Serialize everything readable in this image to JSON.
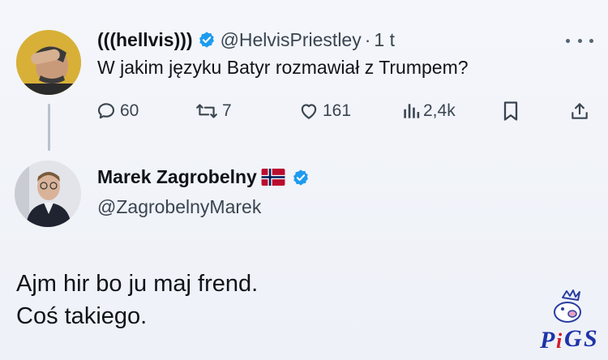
{
  "tweet1": {
    "display_name": "(((hellvis)))",
    "handle": "@HelvisPriestley",
    "separator": "·",
    "time": "1 t",
    "text": "W jakim języku Batyr rozmawiał z Trumpem?",
    "verified": true,
    "stats": {
      "replies": "60",
      "retweets": "7",
      "likes": "161",
      "views": "2,4k"
    }
  },
  "tweet2": {
    "display_name": "Marek Zagrobelny",
    "flag": "Norway",
    "handle": "@ZagrobelnyMarek",
    "verified": true,
    "text_lines": [
      "Ajm hir bo ju maj frend.",
      "Coś takiego."
    ]
  },
  "watermark": {
    "text": "PiGS"
  },
  "colors": {
    "verified_blue": "#1d9bf0",
    "text_primary": "#0f1419",
    "text_secondary": "#536471",
    "background": "#f4f6fb"
  }
}
